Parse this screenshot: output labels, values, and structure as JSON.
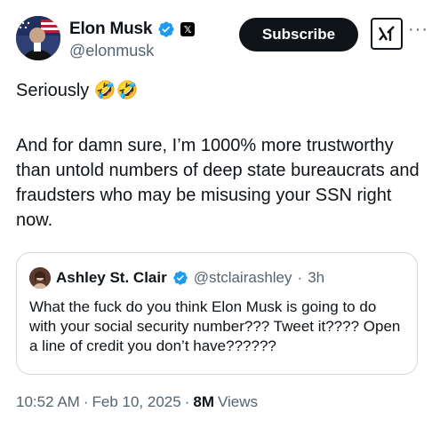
{
  "author": {
    "display_name": "Elon Musk",
    "handle": "@elonmusk",
    "verified_color": "#1d9bf0"
  },
  "actions": {
    "subscribe_label": "Subscribe",
    "more_label": "···"
  },
  "tweet": {
    "paragraph1": "Seriously 🤣🤣",
    "paragraph2": "And for damn sure, I’m 1000% more trustworthy than untold numbers of deep state bureaucrats and fraudsters who may be misusing your SSN right now."
  },
  "quote": {
    "display_name": "Ashley St. Clair",
    "handle": "@stclairashley",
    "separator": "·",
    "time": "3h",
    "text": "What the fuck do you think Elon Musk is going to do with your social security number??? Tweet it???? Open a line of credit you don’t have??????"
  },
  "meta": {
    "time": "10:52 AM",
    "sep1": "·",
    "date": "Feb 10, 2025",
    "sep2": "·",
    "views_count": "8M",
    "views_label": "Views"
  }
}
